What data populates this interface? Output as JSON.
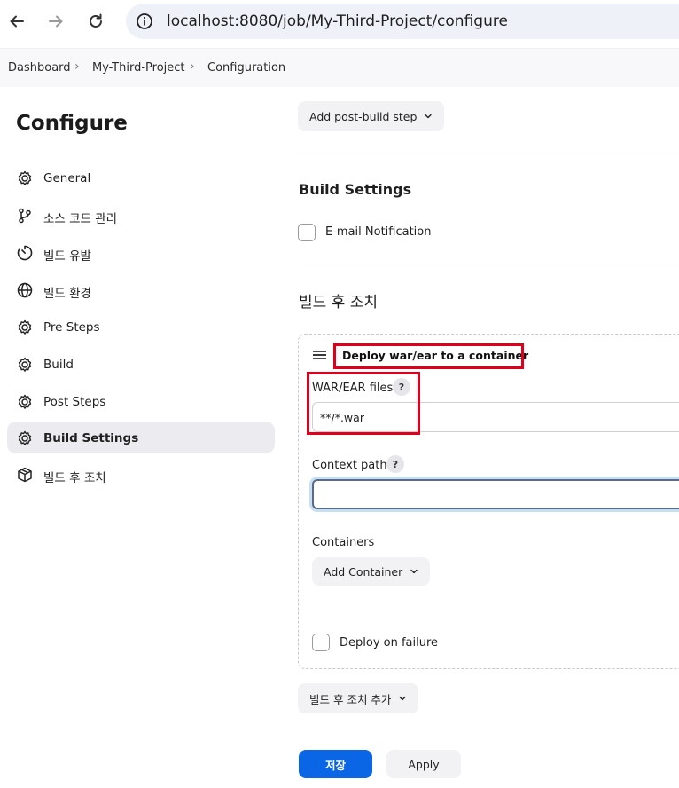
{
  "browser": {
    "url": "localhost:8080/job/My-Third-Project/configure"
  },
  "breadcrumb": [
    "Dashboard",
    "My-Third-Project",
    "Configuration"
  ],
  "sidebar": {
    "title": "Configure",
    "items": [
      {
        "label": "General",
        "icon": "gear-icon"
      },
      {
        "label": "소스 코드 관리",
        "icon": "branch-icon"
      },
      {
        "label": "빌드 유발",
        "icon": "clock-icon"
      },
      {
        "label": "빌드 환경",
        "icon": "globe-icon"
      },
      {
        "label": "Pre Steps",
        "icon": "gear-icon"
      },
      {
        "label": "Build",
        "icon": "gear-icon"
      },
      {
        "label": "Post Steps",
        "icon": "gear-icon"
      },
      {
        "label": "Build Settings",
        "icon": "gear-icon",
        "active": true
      },
      {
        "label": "빌드 후 조치",
        "icon": "package-icon"
      }
    ]
  },
  "main": {
    "add_post_build_step": "Add post-build step",
    "build_settings": {
      "title": "Build Settings",
      "email_notification": "E-mail Notification"
    },
    "post_build": {
      "title": "빌드 후 조치",
      "card_title": "Deploy war/ear to a container",
      "war_label": "WAR/EAR files",
      "war_value": "**/*.war",
      "context_label": "Context path",
      "context_value": "",
      "containers_label": "Containers",
      "add_container": "Add Container",
      "deploy_on_failure": "Deploy on failure",
      "add_action": "빌드 후 조치 추가"
    },
    "help_glyph": "?",
    "save": "저장",
    "apply": "Apply"
  },
  "colors": {
    "primary": "#0a66e4",
    "highlight": "#e0001b"
  }
}
